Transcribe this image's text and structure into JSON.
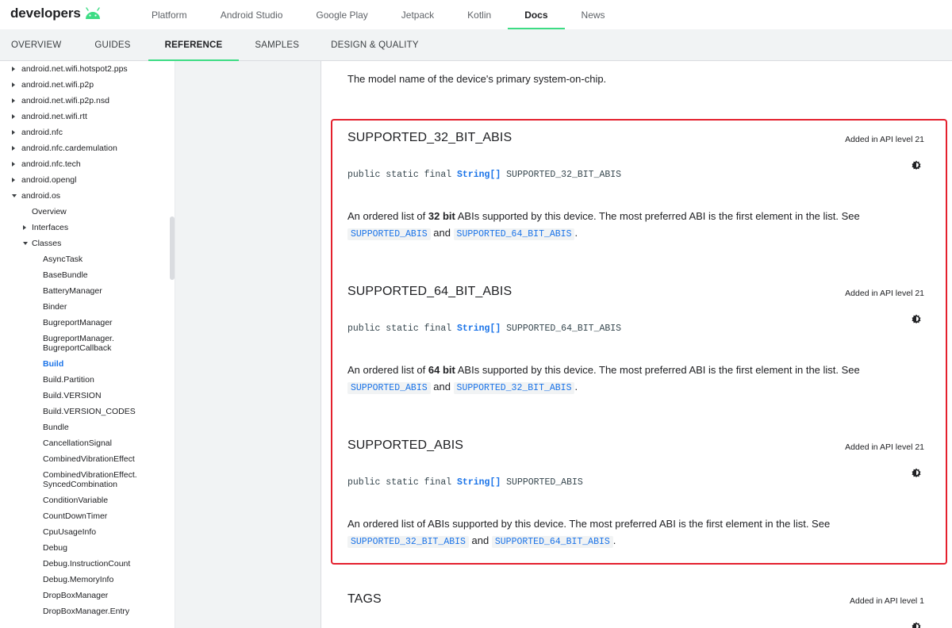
{
  "header": {
    "logo_text": "developers",
    "nav": [
      {
        "label": "Platform"
      },
      {
        "label": "Android Studio"
      },
      {
        "label": "Google Play"
      },
      {
        "label": "Jetpack"
      },
      {
        "label": "Kotlin"
      },
      {
        "label": "Docs",
        "active": true
      },
      {
        "label": "News"
      }
    ],
    "accent_color": "#3ddc84"
  },
  "subnav": [
    {
      "label": "OVERVIEW"
    },
    {
      "label": "GUIDES"
    },
    {
      "label": "REFERENCE",
      "active": true
    },
    {
      "label": "SAMPLES"
    },
    {
      "label": "DESIGN & QUALITY"
    }
  ],
  "sidebar": {
    "items": [
      {
        "label": "android.net.wifi.hotspot2.pps",
        "level": 0,
        "caret": "right"
      },
      {
        "label": "android.net.wifi.p2p",
        "level": 0,
        "caret": "right"
      },
      {
        "label": "android.net.wifi.p2p.nsd",
        "level": 0,
        "caret": "right"
      },
      {
        "label": "android.net.wifi.rtt",
        "level": 0,
        "caret": "right"
      },
      {
        "label": "android.nfc",
        "level": 0,
        "caret": "right"
      },
      {
        "label": "android.nfc.cardemulation",
        "level": 0,
        "caret": "right"
      },
      {
        "label": "android.nfc.tech",
        "level": 0,
        "caret": "right"
      },
      {
        "label": "android.opengl",
        "level": 0,
        "caret": "right"
      },
      {
        "label": "android.os",
        "level": 0,
        "caret": "down"
      },
      {
        "label": "Overview",
        "level": 1
      },
      {
        "label": "Interfaces",
        "level": 1,
        "caret": "right"
      },
      {
        "label": "Classes",
        "level": 1,
        "caret": "down"
      },
      {
        "label": "AsyncTask",
        "level": 2
      },
      {
        "label": "BaseBundle",
        "level": 2
      },
      {
        "label": "BatteryManager",
        "level": 2
      },
      {
        "label": "Binder",
        "level": 2
      },
      {
        "label": "BugreportManager",
        "level": 2
      },
      {
        "label": "BugreportManager.",
        "label2": "BugreportCallback",
        "level": 2
      },
      {
        "label": "Build",
        "level": 2,
        "active": true
      },
      {
        "label": "Build.Partition",
        "level": 2
      },
      {
        "label": "Build.VERSION",
        "level": 2
      },
      {
        "label": "Build.VERSION_CODES",
        "level": 2
      },
      {
        "label": "Bundle",
        "level": 2
      },
      {
        "label": "CancellationSignal",
        "level": 2
      },
      {
        "label": "CombinedVibrationEffect",
        "level": 2
      },
      {
        "label": "CombinedVibrationEffect.",
        "label2": "SyncedCombination",
        "level": 2
      },
      {
        "label": "ConditionVariable",
        "level": 2
      },
      {
        "label": "CountDownTimer",
        "level": 2
      },
      {
        "label": "CpuUsageInfo",
        "level": 2
      },
      {
        "label": "Debug",
        "level": 2
      },
      {
        "label": "Debug.InstructionCount",
        "level": 2
      },
      {
        "label": "Debug.MemoryInfo",
        "level": 2
      },
      {
        "label": "DropBoxManager",
        "level": 2
      },
      {
        "label": "DropBoxManager.Entry",
        "level": 2
      }
    ]
  },
  "content": {
    "intro": "The model name of the device's primary system-on-chip.",
    "highlight_color": "#e4202d",
    "members": [
      {
        "title": "SUPPORTED_32_BIT_ABIS",
        "api": "Added in API level 21",
        "sig_prefix": "public static final ",
        "sig_type": "String[]",
        "sig_name": " SUPPORTED_32_BIT_ABIS",
        "desc_a": "An ordered list of ",
        "desc_bold": "32 bit",
        "desc_b": " ABIs supported by this device. The most preferred ABI is the first element in the list. See ",
        "link1": "SUPPORTED_ABIS",
        "conj": " and ",
        "link2": "SUPPORTED_64_BIT_ABIS",
        "end": "."
      },
      {
        "title": "SUPPORTED_64_BIT_ABIS",
        "api": "Added in API level 21",
        "sig_prefix": "public static final ",
        "sig_type": "String[]",
        "sig_name": " SUPPORTED_64_BIT_ABIS",
        "desc_a": "An ordered list of ",
        "desc_bold": "64 bit",
        "desc_b": " ABIs supported by this device. The most preferred ABI is the first element in the list. See ",
        "link1": "SUPPORTED_ABIS",
        "conj": " and ",
        "link2": "SUPPORTED_32_BIT_ABIS",
        "end": "."
      },
      {
        "title": "SUPPORTED_ABIS",
        "api": "Added in API level 21",
        "sig_prefix": "public static final ",
        "sig_type": "String[]",
        "sig_name": " SUPPORTED_ABIS",
        "desc_a": "An ordered list of ABIs supported by this device. The most preferred ABI is the first element in the list. See ",
        "desc_bold": "",
        "desc_b": "",
        "link1": "SUPPORTED_32_BIT_ABIS",
        "conj": " and ",
        "link2": "SUPPORTED_64_BIT_ABIS",
        "end": "."
      },
      {
        "title": "TAGS",
        "api": "Added in API level 1"
      }
    ]
  }
}
